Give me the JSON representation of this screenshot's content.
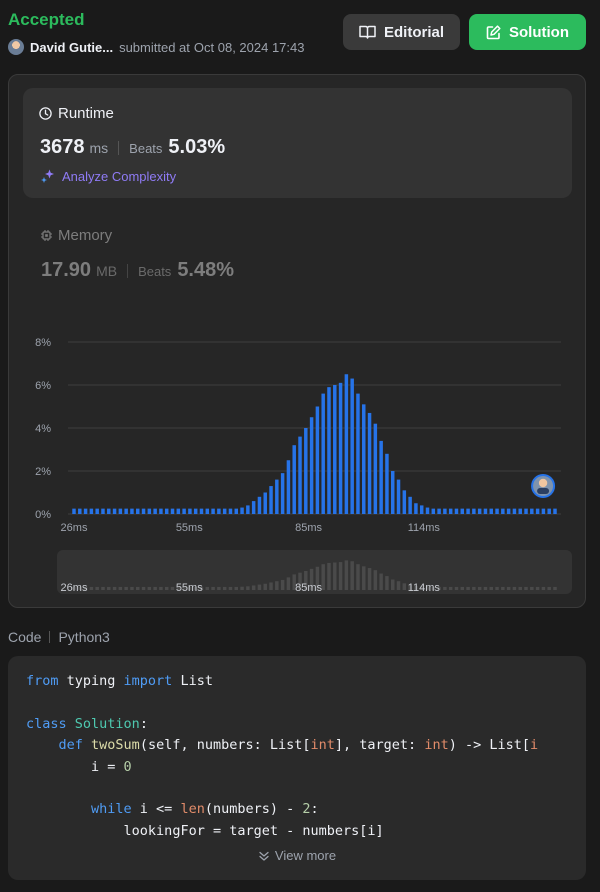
{
  "header": {
    "status": "Accepted",
    "user_name": "David Gutie...",
    "submitted_text": "submitted at",
    "submitted_date": "Oct 08, 2024 17:43",
    "editorial_label": "Editorial",
    "solution_label": "Solution"
  },
  "runtime": {
    "title": "Runtime",
    "value": "3678",
    "unit": "ms",
    "beats_label": "Beats",
    "beats_value": "5.03%",
    "analyze_label": "Analyze Complexity"
  },
  "memory": {
    "title": "Memory",
    "value": "17.90",
    "unit": "MB",
    "beats_label": "Beats",
    "beats_value": "5.48%"
  },
  "colors": {
    "accepted": "#2cbb5d",
    "bar": "#2673e8",
    "overview_bar": "#4a4a4a",
    "analyze": "#8f7bf5"
  },
  "chart_data": {
    "type": "bar",
    "ylim": [
      0,
      8
    ],
    "yticks": [
      "0%",
      "2%",
      "4%",
      "6%",
      "8%"
    ],
    "xtick_labels": [
      "26ms",
      "55ms",
      "85ms",
      "114ms"
    ],
    "xlim_ms": [
      26,
      147
    ],
    "grid": true,
    "marker_at_ms": 144,
    "values": [
      0.25,
      0.25,
      0.25,
      0.25,
      0.25,
      0.25,
      0.25,
      0.25,
      0.25,
      0.25,
      0.25,
      0.25,
      0.25,
      0.25,
      0.25,
      0.25,
      0.25,
      0.25,
      0.25,
      0.25,
      0.25,
      0.25,
      0.25,
      0.25,
      0.25,
      0.25,
      0.25,
      0.25,
      0.25,
      0.3,
      0.4,
      0.6,
      0.8,
      1.0,
      1.3,
      1.6,
      1.9,
      2.5,
      3.2,
      3.6,
      4.0,
      4.5,
      5.0,
      5.6,
      5.9,
      6.0,
      6.1,
      6.5,
      6.3,
      5.6,
      5.1,
      4.7,
      4.2,
      3.4,
      2.8,
      2.0,
      1.6,
      1.1,
      0.8,
      0.5,
      0.4,
      0.3,
      0.25,
      0.25,
      0.25,
      0.25,
      0.25,
      0.25,
      0.25,
      0.25,
      0.25,
      0.25,
      0.25,
      0.25,
      0.25,
      0.25,
      0.25,
      0.25,
      0.25,
      0.25,
      0.25,
      0.25,
      0.25,
      0.25
    ]
  },
  "code": {
    "label": "Code",
    "language": "Python3",
    "view_more": "View more",
    "line1_kw1": "from",
    "line1_mod": " typing ",
    "line1_kw2": "import",
    "line1_name": " List",
    "line3_kw": "class",
    "line3_name": "Solution",
    "line3_colon": ":",
    "line4_kw": "def",
    "line4_fn": "twoSum",
    "line4_a": "(self, numbers: List[",
    "line4_int1": "int",
    "line4_b": "], target: ",
    "line4_int2": "int",
    "line4_c": ") -> List[",
    "line4_i": "i",
    "line5_a": "i = ",
    "line5_num": "0",
    "line7_kw": "while",
    "line7_a": " i <= ",
    "line7_bi": "len",
    "line7_b": "(numbers) - ",
    "line7_num": "2",
    "line7_c": ":",
    "line8": "lookingFor = target - numbers[i]"
  }
}
